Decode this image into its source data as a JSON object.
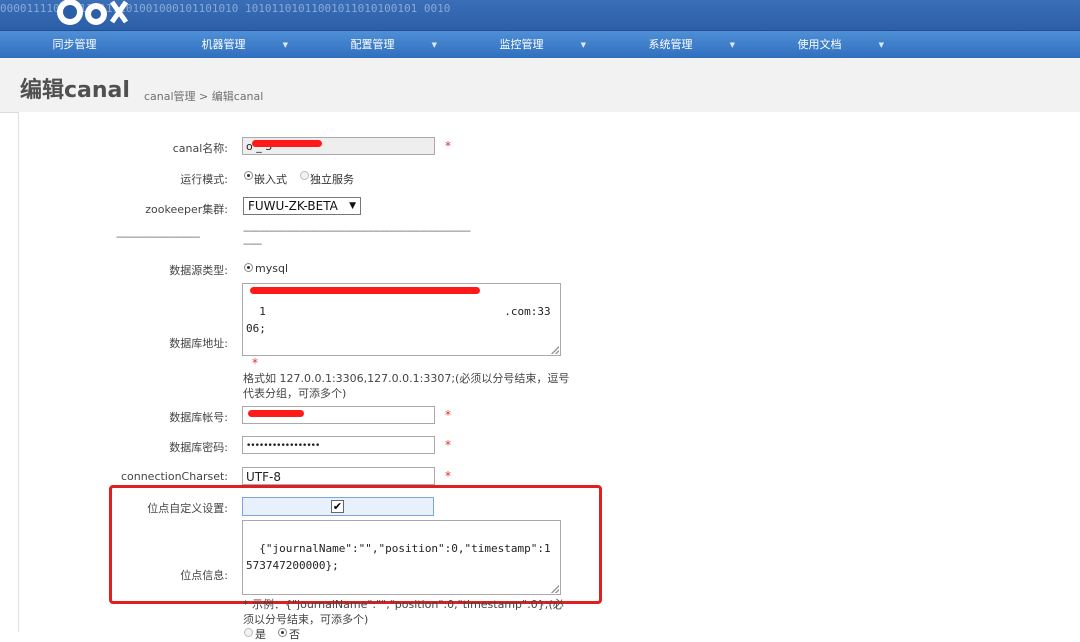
{
  "nav": {
    "items": [
      {
        "label": "同步管理",
        "caret": false
      },
      {
        "label": "机器管理",
        "caret": true
      },
      {
        "label": "配置管理",
        "caret": true
      },
      {
        "label": "监控管理",
        "caret": true
      },
      {
        "label": "系统管理",
        "caret": true
      },
      {
        "label": "使用文档",
        "caret": true
      }
    ],
    "caret_glyph": "▼"
  },
  "banner": {
    "binary_text": "0000111100 0111111101001000101101010 10101101011001011010100101 0010"
  },
  "page": {
    "title": "编辑canal",
    "breadcrumb": "canal管理 > 编辑canal"
  },
  "form": {
    "canal_name": {
      "label": "canal名称:",
      "value": "o      _   3"
    },
    "run_mode": {
      "label": "运行模式:",
      "options": [
        "嵌入式",
        "独立服务"
      ],
      "selected": "嵌入式"
    },
    "zookeeper": {
      "label": "zookeeper集群:",
      "value": "FUWU-ZK-BETA"
    },
    "separator_left": "--------------------------------",
    "separator_right": "---------------------------------------------------------------------------------------",
    "separator_right_tail": "-------",
    "datasource_type": {
      "label": "数据源类型:",
      "value": "mysql"
    },
    "db_address": {
      "label": "数据库地址:",
      "value": "1                                    .com:3306;",
      "hint": "格式如 127.0.0.1:3306,127.0.0.1:3307;(必须以分号结束，逗号代表分组，可添多个)"
    },
    "db_account": {
      "label": "数据库帐号:",
      "value": ""
    },
    "db_password": {
      "label": "数据库密码:",
      "value": "•••••••••••••••••"
    },
    "charset": {
      "label": "connectionCharset:",
      "value": "UTF-8"
    },
    "position_custom": {
      "label": "位点自定义设置:",
      "check_glyph": "✔",
      "checked": true
    },
    "position_info": {
      "label": "位点信息:",
      "value": "{\"journalName\":\"\",\"position\":0,\"timestamp\":1573747200000};",
      "hint": "* 示例：{\"journalName\":\"\",\"position\":0,\"timestamp\":0};(必须以分号结束，可添多个)"
    },
    "bottom_radio": {
      "options": [
        "是",
        "否"
      ],
      "selected": "否"
    },
    "required_mark": "*"
  },
  "colors": {
    "accent": "#2f6fbf",
    "highlight": "#e02020",
    "redaction": "#ff1a1a"
  }
}
